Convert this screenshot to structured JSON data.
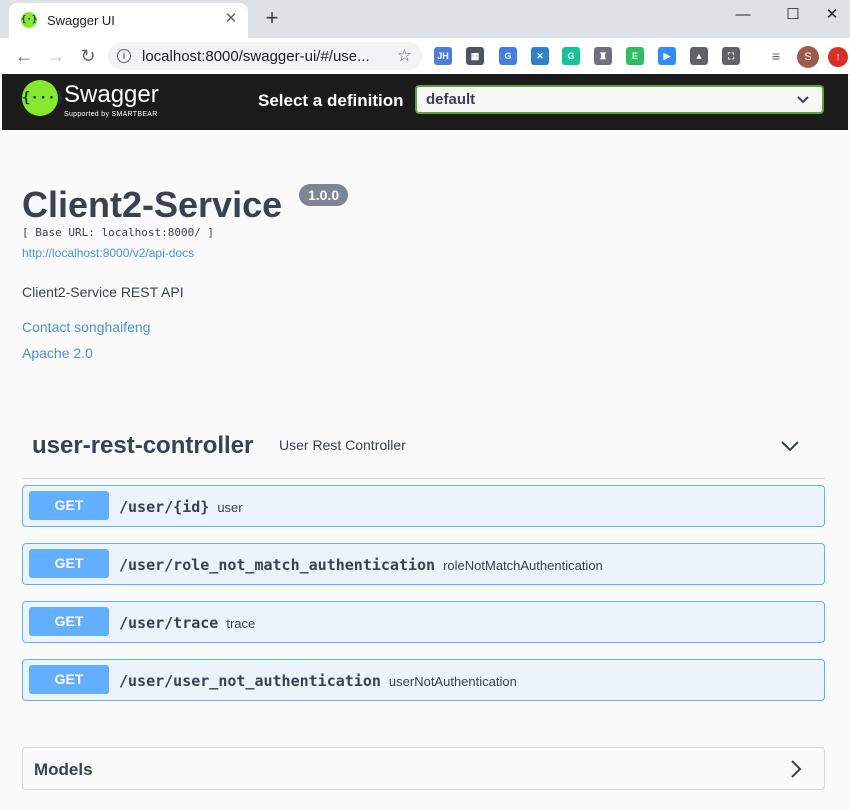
{
  "browser": {
    "tab_title": "Swagger UI",
    "favicon_text": "{·}",
    "url": "localhost:8000/swagger-ui/#/use...",
    "extensions": [
      {
        "name": "jh-extension-icon",
        "text": "JH",
        "color": "#4c7ddb"
      },
      {
        "name": "qr-code-icon",
        "text": "▦",
        "color": "#4b5563"
      },
      {
        "name": "translate-icon",
        "text": "G",
        "color": "#3f7ee8"
      },
      {
        "name": "tools-icon",
        "text": "✕",
        "color": "#2d7fd3"
      },
      {
        "name": "grammarly-icon",
        "text": "G",
        "color": "#15c39a"
      },
      {
        "name": "shield-icon",
        "text": "♜",
        "color": "#6b7280"
      },
      {
        "name": "evernote-icon",
        "text": "E",
        "color": "#2dbe60"
      },
      {
        "name": "zoom-icon",
        "text": "▶",
        "color": "#2d8cff"
      },
      {
        "name": "drive-icon",
        "text": "▲",
        "color": "#5f6368"
      },
      {
        "name": "capture-icon",
        "text": "⛶",
        "color": "#5f6368"
      }
    ],
    "avatar_letter": "S",
    "update_symbol": "↑"
  },
  "topbar": {
    "logo_text": "Swagger",
    "logo_sub": "Supported by SMARTBEAR",
    "select_label": "Select a definition",
    "selected": "default"
  },
  "info": {
    "title": "Client2-Service",
    "version": "1.0.0",
    "base_url": "[ Base URL: localhost:8000/ ]",
    "docs_link": "http://localhost:8000/v2/api-docs",
    "description": "Client2-Service REST API",
    "contact": "Contact songhaifeng",
    "license": "Apache 2.0"
  },
  "tag": {
    "name": "user-rest-controller",
    "description": "User Rest Controller"
  },
  "operations": [
    {
      "method": "GET",
      "path": "/user/{id}",
      "summary": "user"
    },
    {
      "method": "GET",
      "path": "/user/role_not_match_authentication",
      "summary": "roleNotMatchAuthentication"
    },
    {
      "method": "GET",
      "path": "/user/trace",
      "summary": "trace"
    },
    {
      "method": "GET",
      "path": "/user/user_not_authentication",
      "summary": "userNotAuthentication"
    }
  ],
  "models": {
    "title": "Models"
  },
  "colors": {
    "get": "#61affe",
    "get_bg": "#ebf3fb",
    "accent_green": "#85ea2d",
    "link": "#4990e2"
  }
}
